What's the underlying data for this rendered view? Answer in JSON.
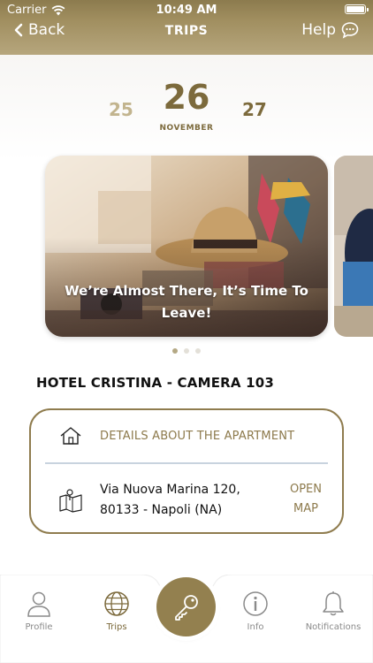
{
  "status_bar": {
    "carrier": "Carrier",
    "time": "10:49 AM"
  },
  "nav": {
    "back_label": "Back",
    "title": "TRIPS",
    "help_label": "Help"
  },
  "date_picker": {
    "prev_day": "25",
    "current_day": "26",
    "current_month": "NOVEMBER",
    "next_day": "27"
  },
  "carousel": {
    "caption": "We’re Almost There, It’s Time To Leave!",
    "page_count": 3,
    "active_page": 1
  },
  "hotel": {
    "title": "HOTEL CRISTINA - CAMERA 103"
  },
  "info": {
    "details_label": "DETAILS ABOUT THE APARTMENT",
    "address_line1": "Via Nuova Marina 120,",
    "address_line2": "80133 - Napoli (NA)",
    "open_label": "OPEN",
    "map_label": "MAP"
  },
  "tabs": [
    {
      "label": "Profile",
      "icon": "person-icon"
    },
    {
      "label": "Trips",
      "icon": "globe-icon"
    },
    {
      "label": "",
      "icon": "key-icon"
    },
    {
      "label": "Info",
      "icon": "info-icon"
    },
    {
      "label": "Notifications",
      "icon": "bell-icon"
    }
  ],
  "colors": {
    "accent": "#93804f",
    "accent_light": "#c2b48e",
    "divider": "#c8d3de",
    "header": "#a08e5f"
  }
}
